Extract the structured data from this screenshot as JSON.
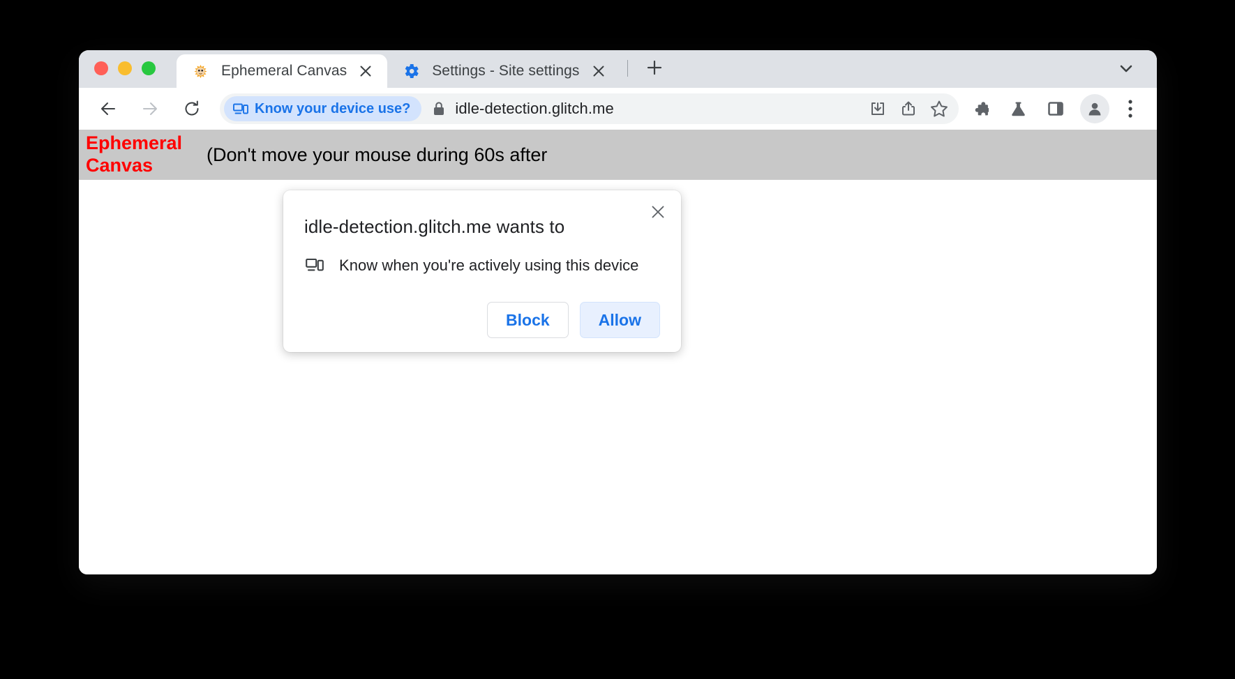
{
  "window": {
    "traffic_lights": [
      "close",
      "minimize",
      "maximize"
    ]
  },
  "tabs": [
    {
      "title": "Ephemeral Canvas",
      "favicon": "pufferfish-icon",
      "active": true,
      "close_label": "×"
    },
    {
      "title": "Settings - Site settings",
      "favicon": "gear-icon",
      "active": false,
      "close_label": "×"
    }
  ],
  "tab_strip": {
    "new_tab_label": "+",
    "tab_search_label": "⌄"
  },
  "toolbar": {
    "back_label": "←",
    "forward_label": "→",
    "reload_label": "↻",
    "permission_chip_label": "Know your device use?",
    "url": "idle-detection.glitch.me",
    "lock_icon": "lock-icon",
    "icons": [
      "install-download-icon",
      "share-icon",
      "bookmark-star-icon",
      "extensions-puzzle-icon",
      "labs-flask-icon",
      "side-panel-icon",
      "profile-avatar-icon",
      "three-dot-menu-icon"
    ]
  },
  "page": {
    "heading": "Ephemeral Canvas",
    "subtext": "(Don't move your mouse during 60s after",
    "banner_background": "#c8c8c8",
    "heading_color": "#ff0000"
  },
  "permission_bubble": {
    "title": "idle-detection.glitch.me wants to",
    "permission_icon": "device-idle-icon",
    "permission_text": "Know when you're actively using this device",
    "close_label": "×",
    "block_label": "Block",
    "allow_label": "Allow",
    "accent_color": "#1a73e8",
    "allow_background": "#e8f0fe"
  }
}
